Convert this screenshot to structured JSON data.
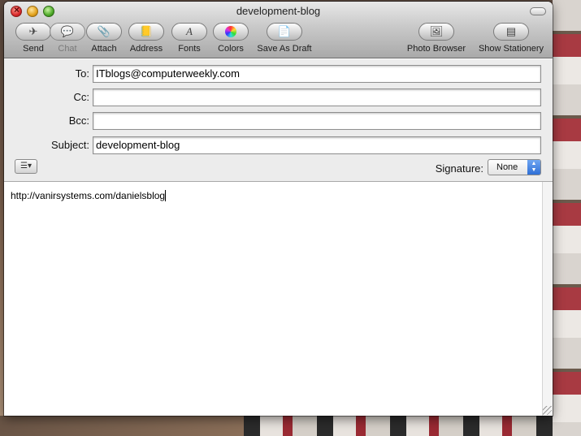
{
  "window": {
    "title": "development-blog"
  },
  "toolbar": {
    "buttons": [
      {
        "id": "send",
        "label": "Send",
        "icon": "paper-plane-icon",
        "glyph": "✈"
      },
      {
        "id": "chat",
        "label": "Chat",
        "icon": "chat-bubble-icon",
        "glyph": "💬",
        "disabled": true
      },
      {
        "id": "attach",
        "label": "Attach",
        "icon": "paperclip-icon",
        "glyph": "📎"
      },
      {
        "id": "address",
        "label": "Address",
        "icon": "address-book-icon",
        "glyph": "📒"
      },
      {
        "id": "fonts",
        "label": "Fonts",
        "icon": "font-icon",
        "glyph": "A"
      },
      {
        "id": "colors",
        "label": "Colors",
        "icon": "color-wheel-icon",
        "glyph": "◉"
      },
      {
        "id": "save_draft",
        "label": "Save As Draft",
        "icon": "draft-document-icon",
        "glyph": "📄"
      },
      {
        "id": "photo_browser",
        "label": "Photo Browser",
        "icon": "photo-icon",
        "glyph": "🖼"
      },
      {
        "id": "show_stationery",
        "label": "Show Stationery",
        "icon": "stationery-icon",
        "glyph": "▤"
      }
    ]
  },
  "headers": {
    "to_label": "To:",
    "to_value": "ITblogs@computerweekly.com",
    "cc_label": "Cc:",
    "cc_value": "",
    "bcc_label": "Bcc:",
    "bcc_value": "",
    "subject_label": "Subject:",
    "subject_value": "development-blog",
    "format_glyph": "☰▾",
    "signature_label": "Signature:",
    "signature_value": "None"
  },
  "body": {
    "text": "http://vanirsystems.com/danielsblog"
  }
}
